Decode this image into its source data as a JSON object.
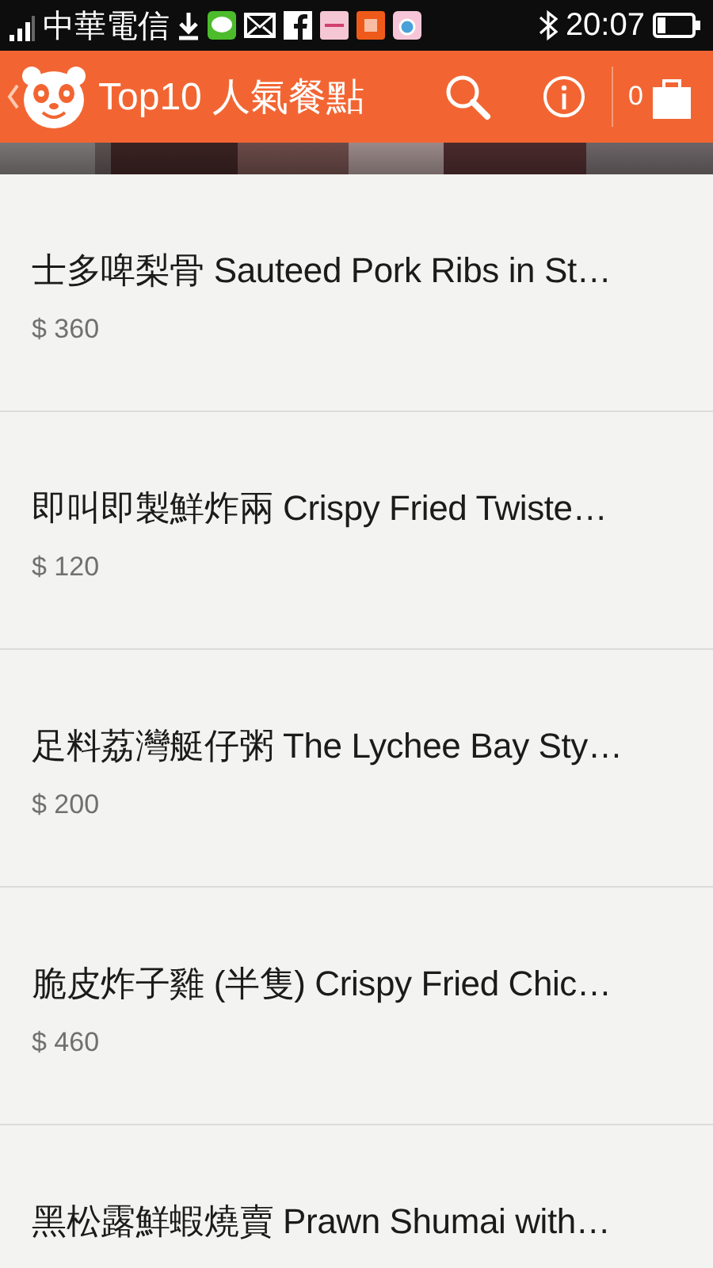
{
  "status_bar": {
    "carrier": "中華電信",
    "time": "20:07"
  },
  "header": {
    "title": "Top10 人氣餐點",
    "cart_count": "0"
  },
  "items": [
    {
      "name": "士多啤梨骨 Sauteed Pork Ribs in St…",
      "price": "$ 360"
    },
    {
      "name": "即叫即製鮮炸兩 Crispy Fried Twiste…",
      "price": "$ 120"
    },
    {
      "name": "足料荔灣艇仔粥 The Lychee Bay Sty…",
      "price": "$ 200"
    },
    {
      "name": "脆皮炸子雞 (半隻) Crispy Fried Chic…",
      "price": "$ 460"
    },
    {
      "name": "黑松露鮮蝦燒賣 Prawn Shumai with…"
    }
  ]
}
